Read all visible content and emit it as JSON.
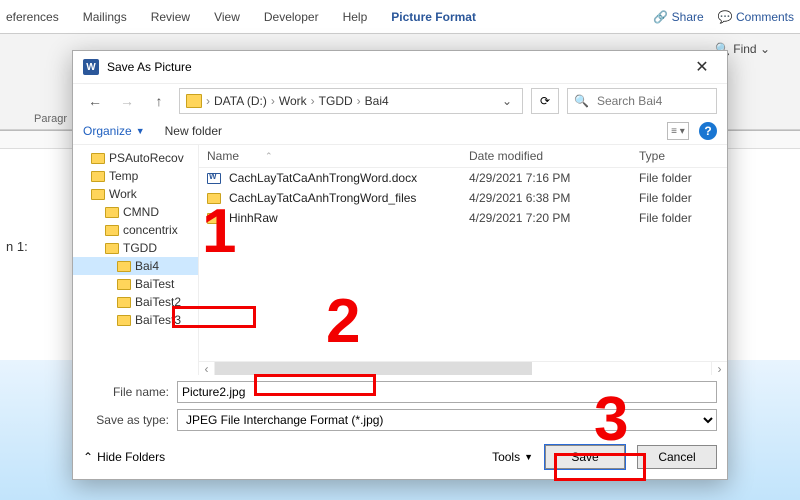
{
  "ribbon": {
    "tabs": [
      "eferences",
      "Mailings",
      "Review",
      "View",
      "Developer",
      "Help",
      "Picture Format"
    ],
    "share": "Share",
    "comments": "Comments"
  },
  "toolbar": {
    "find": "Find",
    "group": "Paragr"
  },
  "doc_label": "n 1:",
  "dialog": {
    "title": "Save As Picture",
    "breadcrumb": [
      "DATA (D:)",
      "Work",
      "TGDD",
      "Bai4"
    ],
    "search_placeholder": "Search Bai4",
    "organize": "Organize",
    "new_folder": "New folder"
  },
  "tree": [
    {
      "label": "PSAutoRecov",
      "depth": 0
    },
    {
      "label": "Temp",
      "depth": 0
    },
    {
      "label": "Work",
      "depth": 0
    },
    {
      "label": "CMND",
      "depth": 1
    },
    {
      "label": "concentrix",
      "depth": 1
    },
    {
      "label": "TGDD",
      "depth": 1
    },
    {
      "label": "Bai4",
      "depth": 2,
      "selected": true
    },
    {
      "label": "BaiTest",
      "depth": 2
    },
    {
      "label": "BaiTest2",
      "depth": 2
    },
    {
      "label": "BaiTest3",
      "depth": 2
    }
  ],
  "columns": {
    "name": "Name",
    "date": "Date modified",
    "type": "Type"
  },
  "files": [
    {
      "name": "CachLayTatCaAnhTrongWord.docx",
      "date": "4/29/2021 7:16 PM",
      "type": "File folder",
      "doc": true
    },
    {
      "name": "CachLayTatCaAnhTrongWord_files",
      "date": "4/29/2021 6:38 PM",
      "type": "File folder",
      "doc": false
    },
    {
      "name": "HinhRaw",
      "date": "4/29/2021 7:20 PM",
      "type": "File folder",
      "doc": false
    }
  ],
  "fields": {
    "name_label": "File name:",
    "name_value": "Picture2.jpg",
    "type_label": "Save as type:",
    "type_value": "JPEG File Interchange Format (*.jpg)"
  },
  "footer": {
    "hide": "Hide Folders",
    "tools": "Tools",
    "save": "Save",
    "cancel": "Cancel"
  },
  "annotations": {
    "n1": "1",
    "n2": "2",
    "n3": "3"
  }
}
